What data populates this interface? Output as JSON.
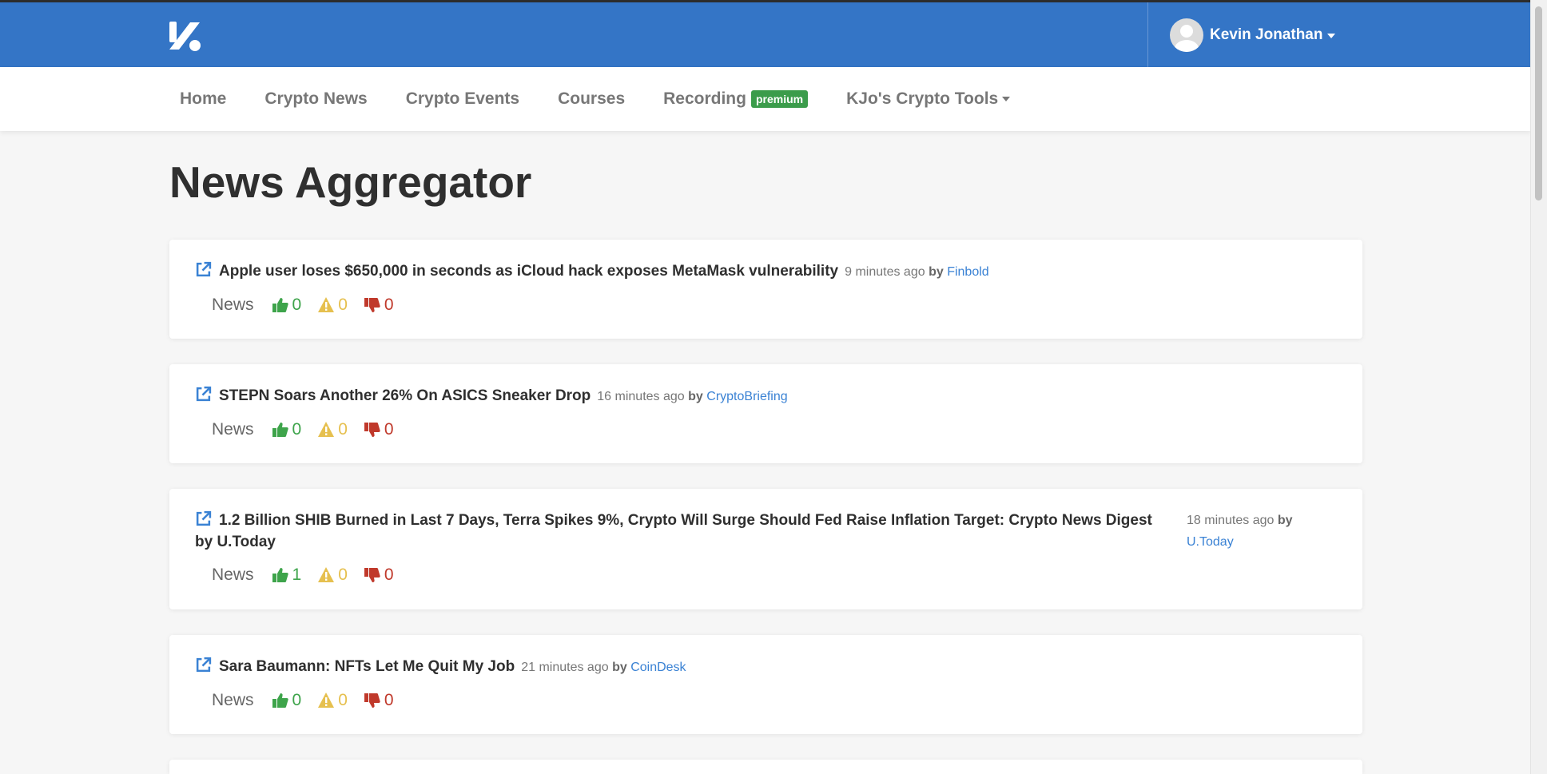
{
  "header": {
    "user_name": "Kevin Jonathan"
  },
  "nav": {
    "items": [
      {
        "label": "Home"
      },
      {
        "label": "Crypto News"
      },
      {
        "label": "Crypto Events"
      },
      {
        "label": "Courses"
      },
      {
        "label": "Recording",
        "badge": "premium"
      },
      {
        "label": "KJo's Crypto Tools"
      }
    ]
  },
  "page": {
    "title": "News Aggregator"
  },
  "articles": [
    {
      "title": "Apple user loses $650,000 in seconds as iCloud hack exposes MetaMask vulnerability",
      "time": "9 minutes ago",
      "by": "by",
      "source": "Finbold",
      "tag": "News",
      "up": "0",
      "warn": "0",
      "down": "0"
    },
    {
      "title": "STEPN Soars Another 26% On ASICS Sneaker Drop",
      "time": "16 minutes ago",
      "by": "by",
      "source": "CryptoBriefing",
      "tag": "News",
      "up": "0",
      "warn": "0",
      "down": "0"
    },
    {
      "title": "1.2 Billion SHIB Burned in Last 7 Days, Terra Spikes 9%, Crypto Will Surge Should Fed Raise Inflation Target: Crypto News Digest by U.Today",
      "time": "18 minutes ago",
      "by": "by",
      "source": "U.Today",
      "tag": "News",
      "up": "1",
      "warn": "0",
      "down": "0"
    },
    {
      "title": "Sara Baumann: NFTs Let Me Quit My Job",
      "time": "21 minutes ago",
      "by": "by",
      "source": "CoinDesk",
      "tag": "News",
      "up": "0",
      "warn": "0",
      "down": "0"
    }
  ],
  "colors": {
    "header_bg": "#3475c6",
    "link": "#3a82d4",
    "upvote": "#3ea44b",
    "warning": "#e6c04f",
    "downvote": "#c0392b",
    "badge": "#3b9c4b"
  }
}
